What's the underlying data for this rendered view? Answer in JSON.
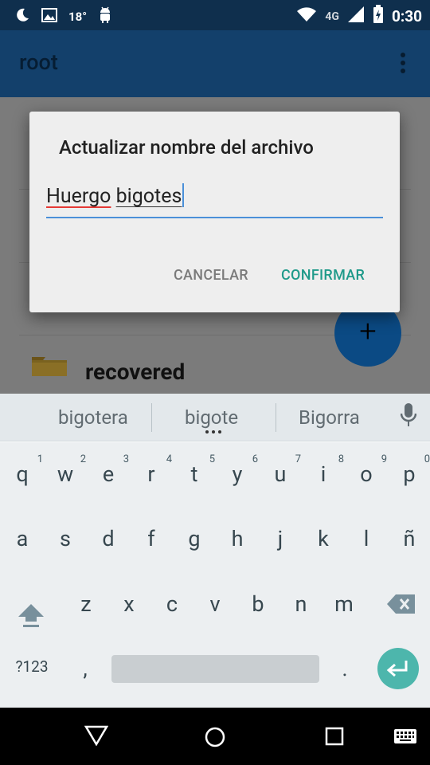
{
  "status_bar": {
    "temperature": "18°",
    "network": "4G",
    "time": "0:30",
    "icons": [
      "moon-icon",
      "image-icon",
      "android-icon",
      "wifi-icon",
      "signal-icon",
      "battery-charging-icon"
    ]
  },
  "app_bar": {
    "title": "root",
    "overflow_icon": "more-vert-icon"
  },
  "background_list": {
    "folder_name": "recovered",
    "fab_icon": "plus-icon"
  },
  "dialog": {
    "title": "Actualizar nombre del archivo",
    "input_word1": "Huergo",
    "input_word2": "bigotes",
    "cancel_label": "CANCELAR",
    "confirm_label": "CONFIRMAR"
  },
  "keyboard": {
    "suggestions": [
      "bigotera",
      "bigote",
      "Bigorra"
    ],
    "row1": [
      {
        "k": "q",
        "h": "1"
      },
      {
        "k": "w",
        "h": "2"
      },
      {
        "k": "e",
        "h": "3"
      },
      {
        "k": "r",
        "h": "4"
      },
      {
        "k": "t",
        "h": "5"
      },
      {
        "k": "y",
        "h": "6"
      },
      {
        "k": "u",
        "h": "7"
      },
      {
        "k": "i",
        "h": "8"
      },
      {
        "k": "o",
        "h": "9"
      },
      {
        "k": "p",
        "h": "0"
      }
    ],
    "row2": [
      "a",
      "s",
      "d",
      "f",
      "g",
      "h",
      "j",
      "k",
      "l",
      "ñ"
    ],
    "row3": [
      "z",
      "x",
      "c",
      "v",
      "b",
      "n",
      "m"
    ],
    "symbols_label": "?123",
    "comma": ",",
    "period": "."
  },
  "nav_bar": {
    "icons": [
      "back-icon",
      "home-icon",
      "recents-icon",
      "keyboard-switch-icon"
    ]
  }
}
